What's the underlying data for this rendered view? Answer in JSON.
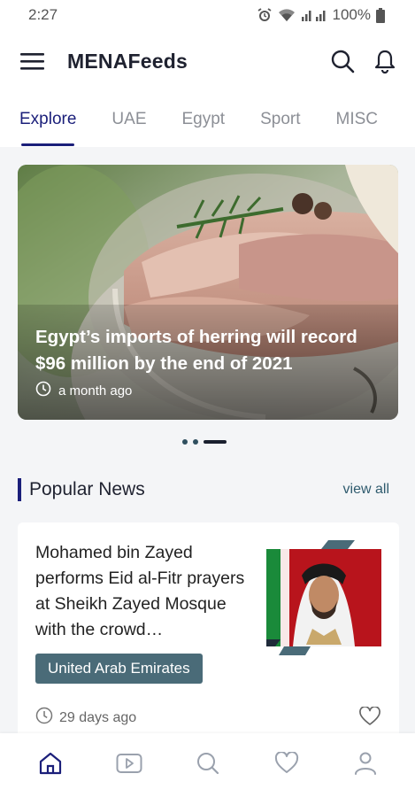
{
  "status_bar": {
    "time": "2:27",
    "battery": "100%"
  },
  "app": {
    "title": "MENAFeeds"
  },
  "tabs": [
    {
      "label": "Explore",
      "active": true
    },
    {
      "label": "UAE",
      "active": false
    },
    {
      "label": "Egypt",
      "active": false
    },
    {
      "label": "Sport",
      "active": false
    },
    {
      "label": "MISC",
      "active": false
    }
  ],
  "hero": {
    "title": "Egypt’s imports of herring will record $96 million by the end of 2021",
    "time": "a month ago",
    "carousel": {
      "count": 3,
      "active_index": 2
    }
  },
  "popular": {
    "title": "Popular News",
    "view_all": "view all",
    "card": {
      "headline": "Mohamed bin Zayed performs Eid al-Fitr prayers at Sheikh Zayed Mosque with the crowd…",
      "tag": "United Arab Emirates",
      "time": "29 days ago"
    }
  },
  "bottom_nav": [
    {
      "icon": "home-icon",
      "active": true
    },
    {
      "icon": "video-icon",
      "active": false
    },
    {
      "icon": "search-icon",
      "active": false
    },
    {
      "icon": "heart-icon",
      "active": false
    },
    {
      "icon": "user-icon",
      "active": false
    }
  ],
  "colors": {
    "accent": "#1b1f7a",
    "tag_bg": "#4a6b78",
    "background": "#f4f5f7"
  }
}
